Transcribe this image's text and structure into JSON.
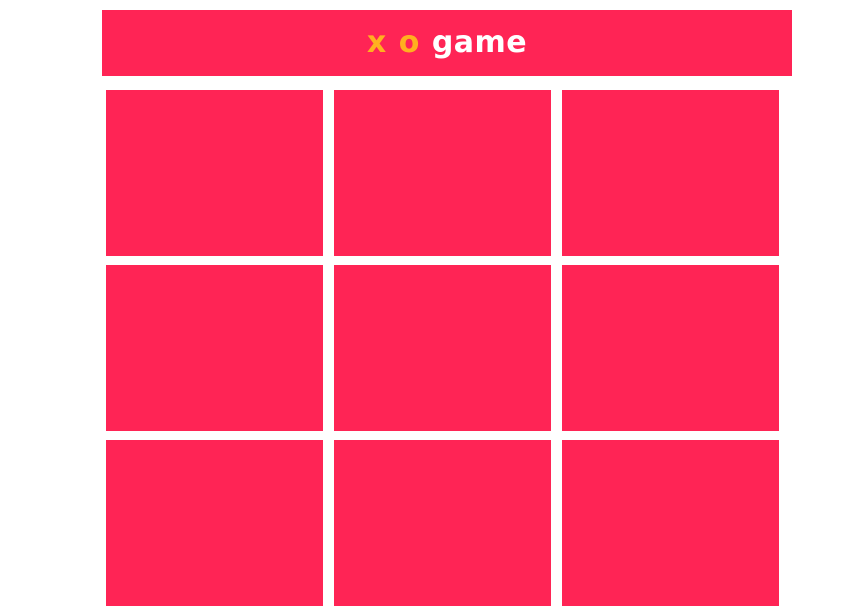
{
  "title": {
    "x": "x",
    "o": "o",
    "game": "game"
  },
  "colors": {
    "primary": "#ff2455",
    "accent": "#ffb01f",
    "text": "#ffffff",
    "background": "#ffffff"
  },
  "board": {
    "cells": [
      "",
      "",
      "",
      "",
      "",
      "",
      "",
      "",
      ""
    ]
  }
}
